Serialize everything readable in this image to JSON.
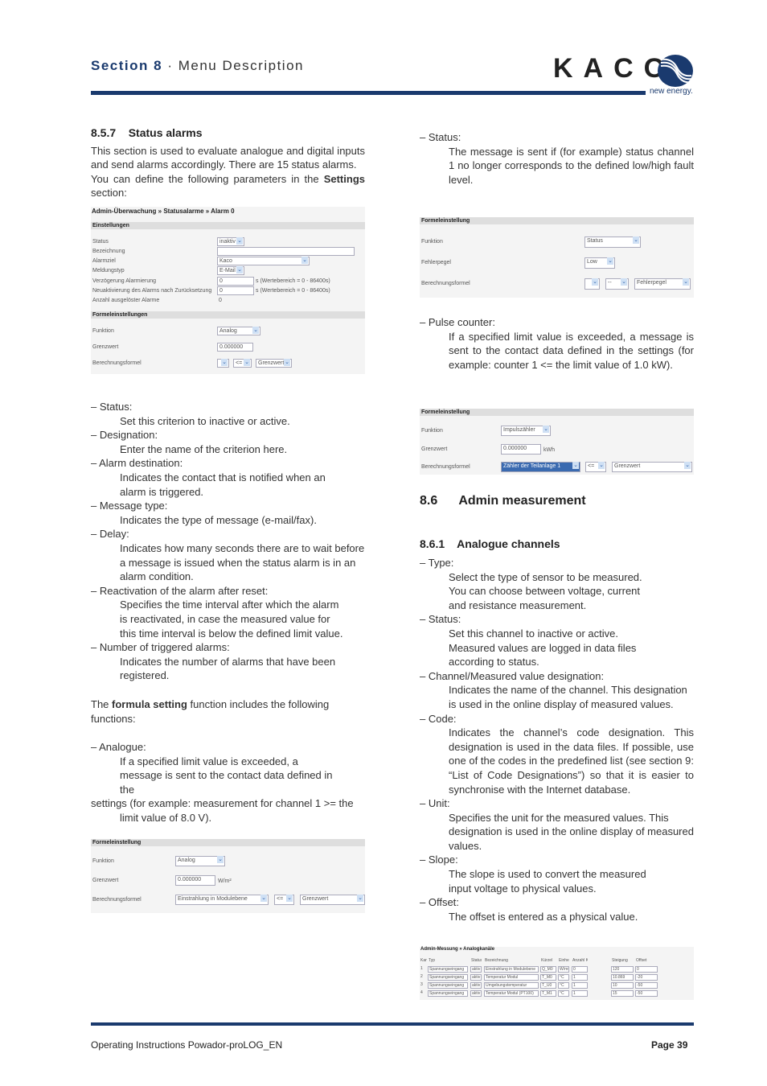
{
  "header": {
    "section": "Section 8",
    "separator": " · ",
    "title": "Menu Description",
    "logo": "KACO",
    "tagline": "new energy."
  },
  "footer": {
    "doc": "Operating Instructions Powador-proLOG_EN",
    "page": "Page 39"
  },
  "left": {
    "heading": "8.5.7    Status alarms",
    "intro": "This section is used to evaluate analogue and digital inputs and send alarms accordingly.  There are 15 status alarms.",
    "intro2_pre": "You can define the following parameters in the ",
    "intro2_bold": "Settings",
    "intro2_post": " section:",
    "screenshot1": {
      "title": "Admin-Überwachung » Statusalarme » Alarm 0",
      "bar1": "Einstellungen",
      "rows": [
        {
          "label": "Status",
          "value": "inaktiv"
        },
        {
          "label": "Bezeichnung",
          "value": ""
        },
        {
          "label": "Alarmziel",
          "value": "Kaco"
        },
        {
          "label": "Meldungstyp",
          "value": "E-Mail"
        },
        {
          "label": "Verzögerung Alarmierung",
          "value": "0",
          "unit": "s   (Wertebereich = 0 - 86400s)"
        },
        {
          "label": "Neuaktivierung des Alarms nach Zurücksetzung",
          "value": "0",
          "unit": "s   (Wertebereich = 0 - 86400s)"
        },
        {
          "label": "Anzahl ausgelöster Alarme",
          "value": "0"
        }
      ],
      "bar2": "Formeleinstellungen",
      "formula": [
        {
          "label": "Funktion",
          "value": "Analog"
        },
        {
          "label": "Grenzwert",
          "value": "0.000000"
        },
        {
          "label": "Berechnungsformel",
          "v1": "",
          "v2": "<=",
          "v3": "Grenzwert"
        }
      ]
    },
    "items": [
      {
        "label": "–  Status:",
        "desc": "Set this criterion to inactive or active."
      },
      {
        "label": "–  Designation:",
        "desc": "Enter the name of the criterion here."
      },
      {
        "label": "–  Alarm destination:",
        "desc": "Indicates the contact that is notified when an alarm is triggered."
      },
      {
        "label": "–  Message type:",
        "desc": "Indicates the type of message (e-mail/fax)."
      },
      {
        "label": "–  Delay:",
        "desc": "Indicates how many seconds there are to wait before a message is issued when the status alarm is in an alarm condition."
      },
      {
        "label": "–  Reactivation of the alarm after reset:",
        "desc": "Specifies the time interval after which the alarm is reactivated, in case the measured value for this time interval is below the defined limit value."
      },
      {
        "label": "–  Number of triggered alarms:",
        "desc": "Indicates the number of alarms that have been registered."
      }
    ],
    "formula_pre": "The ",
    "formula_bold": "formula setting",
    "formula_post": " function includes the following functions:",
    "analogue_label": "–  Analogue:",
    "analogue_desc1": "If a specified limit value is exceeded, a message is sent to the contact data defined in the",
    "analogue_desc2": "settings (for example: measurement for channel 1 >= the",
    "analogue_desc3": "limit value of 8.0 V).",
    "screenshot2": {
      "bar": "Formeleinstellung",
      "funktion_label": "Funktion",
      "funktion": "Analog",
      "grenz_label": "Grenzwert",
      "grenz": "0.000000",
      "unit": "W/m²",
      "formel_label": "Berechnungsformel",
      "v1": "Einstrahlung in Modulebene",
      "v2": "<=",
      "v3": "Grenzwert"
    }
  },
  "right": {
    "status_label": "–  Status:",
    "status_desc": "The message is sent if (for example) status channel 1 no longer corresponds to the defined low/high fault level.",
    "screenshot3": {
      "bar": "Formeleinstellung",
      "funktion_label": "Funktion",
      "funktion": "Status",
      "fehler_label": "Fehlerpegel",
      "fehler": "Low",
      "formel_label": "Berechnungsformel",
      "v1": "",
      "v2": "--",
      "v3": "Fehlerpegel"
    },
    "pulse_label": "–  Pulse counter:",
    "pulse_desc": "If a specified limit value is exceeded, a message is sent to the contact data defined in the settings (for example: counter 1 <= the limit value of 1.0 kW).",
    "screenshot4": {
      "bar": "Formeleinstellung",
      "funktion_label": "Funktion",
      "funktion": "Impulszähler",
      "grenz_label": "Grenzwert",
      "grenz": "0.000000",
      "unit": "kWh",
      "formel_label": "Berechnungsformel",
      "v1": "Zähler der Teilanlage 1",
      "v2": "<=",
      "v3": "Grenzwert"
    },
    "h86": "8.6      Admin measurement",
    "h861": "8.6.1    Analogue channels",
    "items": [
      {
        "label": "–  Type:",
        "desc": "Select the type of sensor to be measured. You can choose between voltage, current and resistance measurement."
      },
      {
        "label": "–  Status:",
        "desc": "Set this channel to inactive or active. Measured values are logged in data files according to status."
      },
      {
        "label": "–  Channel/Measured value designation:",
        "desc": "Indicates the name of the channel. This designation is used in the online display of measured values."
      },
      {
        "label": "–  Code:",
        "desc": "Indicates the channel’s code designation. This designation is used in the data files. If possible, use one of the codes in the predefined list (see section 9: “List of Code Designations”) so that it is easier to synchronise with the Internet database."
      },
      {
        "label": "–  Unit:",
        "desc": "Specifies the unit for the measured values. This designation is used in the online display of measured values."
      },
      {
        "label": "–  Slope:",
        "desc": "The slope is used to convert the measured input voltage to physical values."
      },
      {
        "label": "–  Offset:",
        "desc": "The offset is entered as a physical value."
      }
    ],
    "table": {
      "title": "Admin-Messung » Analogkanäle",
      "headers": [
        "Kanal",
        "Typ",
        "Status",
        "Bezeichnung",
        "Kürzel",
        "Einheit",
        "Anzahl Kommastellen",
        "Steigung",
        "Offset"
      ],
      "rows": [
        [
          "1",
          "Spannungseingang",
          "aktiv",
          "Einstrahlung in Modulebene",
          "Q_M0",
          "W/m²",
          "0",
          "120",
          "0"
        ],
        [
          "2",
          "Spannungseingang",
          "aktiv",
          "Temperatur Modul",
          "T_M0",
          "°C",
          "1",
          "10.869",
          "-20"
        ],
        [
          "3",
          "Spannungseingang",
          "aktiv",
          "Umgebungstemperatur",
          "T_U0",
          "°C",
          "1",
          "10",
          "-50"
        ],
        [
          "4",
          "Spannungseingang",
          "aktiv",
          "Temperatur Modul (PT100)",
          "T_M1",
          "°C",
          "1",
          "15",
          "-50"
        ]
      ]
    }
  }
}
